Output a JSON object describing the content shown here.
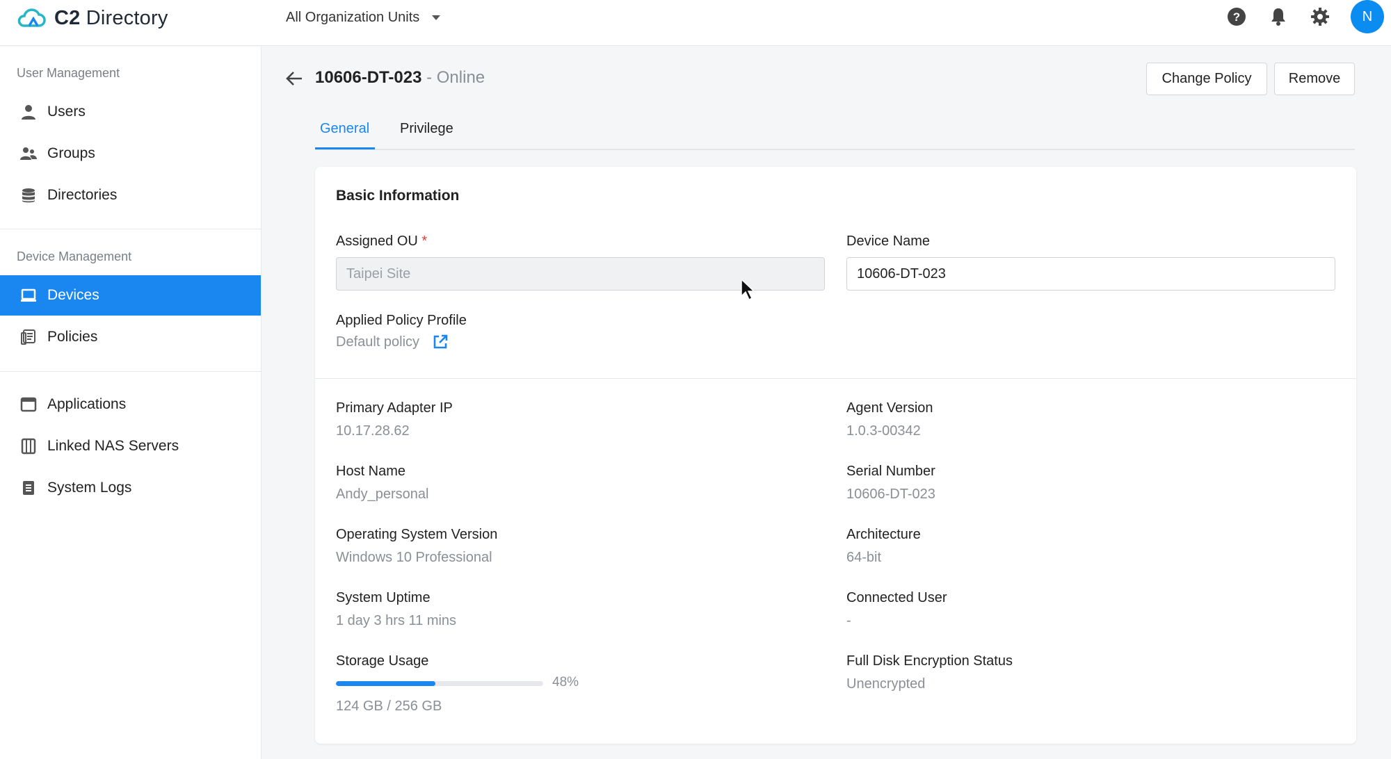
{
  "app": {
    "title_bold": "C2",
    "title_rest": " Directory"
  },
  "org_select": {
    "label": "All Organization Units"
  },
  "user": {
    "initial": "N"
  },
  "colors": {
    "accent": "#1a86f0",
    "avatar": "#0b8cf0",
    "required": "#e53935"
  },
  "sidebar": {
    "sections": [
      {
        "title": "User Management",
        "items": [
          {
            "label": "Users",
            "icon": "user-icon"
          },
          {
            "label": "Groups",
            "icon": "groups-icon"
          },
          {
            "label": "Directories",
            "icon": "database-icon"
          }
        ]
      },
      {
        "title": "Device Management",
        "items": [
          {
            "label": "Devices",
            "icon": "laptop-icon",
            "active": true
          },
          {
            "label": "Policies",
            "icon": "policy-icon"
          }
        ]
      },
      {
        "title": "",
        "items": [
          {
            "label": "Applications",
            "icon": "window-icon"
          },
          {
            "label": "Linked NAS Servers",
            "icon": "nas-icon"
          },
          {
            "label": "System Logs",
            "icon": "logs-icon"
          }
        ]
      }
    ]
  },
  "header": {
    "device_name": "10606-DT-023",
    "status": " - Online",
    "change_policy": "Change Policy",
    "remove": "Remove"
  },
  "tabs": [
    {
      "label": "General",
      "active": true
    },
    {
      "label": "Privilege"
    }
  ],
  "basic": {
    "title": "Basic Information",
    "assigned_ou_label": "Assigned OU",
    "required_mark": " *",
    "assigned_ou_value": "Taipei Site",
    "device_name_label": "Device Name",
    "device_name_value": "10606-DT-023",
    "policy_label": "Applied Policy Profile",
    "policy_value": "Default policy"
  },
  "details": {
    "primary_ip_label": "Primary Adapter IP",
    "primary_ip": "10.17.28.62",
    "agent_label": "Agent Version",
    "agent": "1.0.3-00342",
    "host_label": "Host Name",
    "host": "Andy_personal",
    "serial_label": "Serial Number",
    "serial": "10606-DT-023",
    "os_label": "Operating System Version",
    "os": "Windows 10 Professional",
    "arch_label": "Architecture",
    "arch": "64-bit",
    "uptime_label": "System Uptime",
    "uptime": "1 day 3 hrs 11 mins",
    "connected_label": "Connected User",
    "connected": "-",
    "storage_label": "Storage Usage",
    "storage_percent": 48,
    "storage_percent_text": "48%",
    "storage_text": "124 GB / 256 GB",
    "encryption_label": "Full Disk Encryption Status",
    "encryption": "Unencrypted"
  }
}
